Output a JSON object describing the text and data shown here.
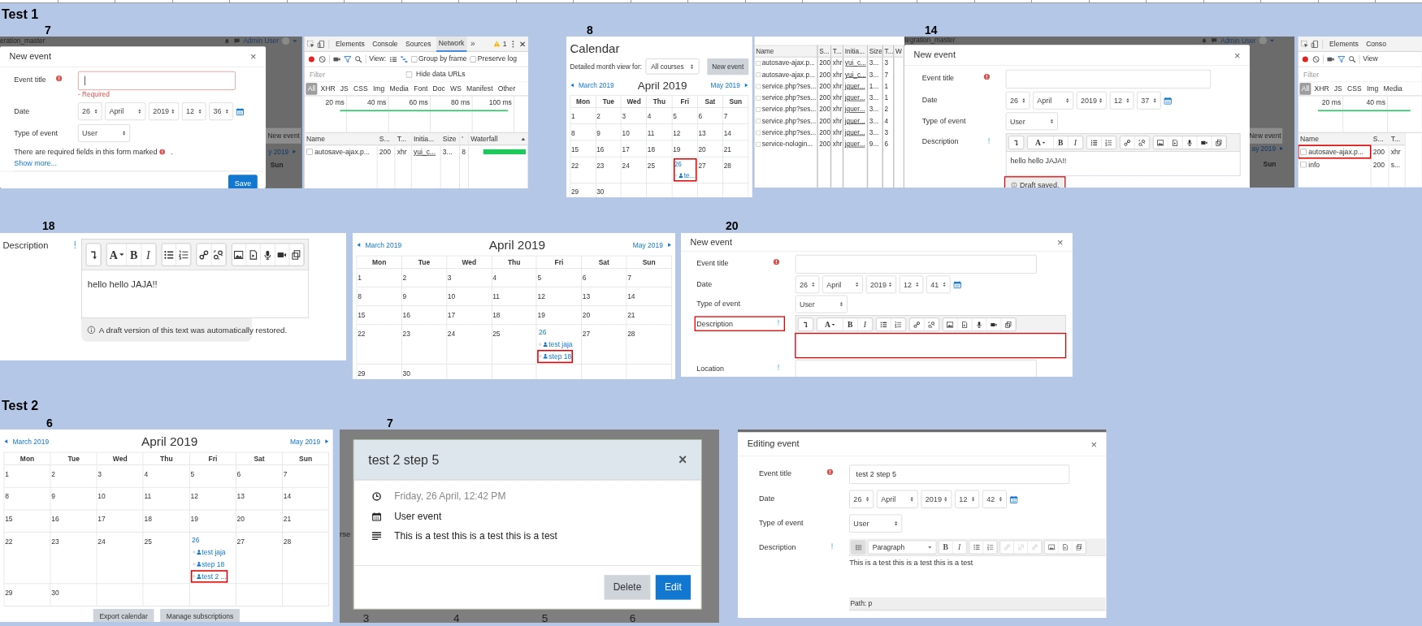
{
  "tests": [
    {
      "title": "Test 1",
      "steps": [
        {
          "label": "7",
          "panels": [
            {
              "kind": "event_form",
              "backdrop": {
                "site_name": "eration_master",
                "user_name": "Admin User",
                "button": "New event",
                "nav": "y 2019",
                "weekday": "Sun"
              },
              "title": "New event",
              "close": "×",
              "fields": [
                {
                  "kind": "text",
                  "label": "Event title",
                  "required": true,
                  "focused": true,
                  "error": "- Required"
                },
                {
                  "kind": "date",
                  "label": "Date",
                  "day": "26",
                  "month": "April",
                  "year": "2019",
                  "hour": "12",
                  "minute": "36"
                },
                {
                  "kind": "select",
                  "label": "Type of event",
                  "value": "User"
                }
              ],
              "required_note": {
                "text": "There are required fields in this form marked",
                "end": "."
              },
              "show_more": "Show more...",
              "save": "Save"
            },
            {
              "kind": "devtools",
              "tabs": [
                {
                  "label": "Elements",
                  "selected": false
                },
                {
                  "label": "Console",
                  "selected": false
                },
                {
                  "label": "Sources",
                  "selected": false
                },
                {
                  "label": "Network",
                  "selected": true
                }
              ],
              "more": "»",
              "warnings": "1",
              "view_label": "View:",
              "options": [
                {
                  "label": "Group by frame",
                  "checked": false
                },
                {
                  "label": "Preserve log",
                  "checked": false
                }
              ],
              "filter_placeholder": "Filter",
              "hide_option": {
                "label": "Hide data URLs",
                "checked": false
              },
              "types": [
                {
                  "label": "All",
                  "selected": true
                },
                {
                  "label": "XHR",
                  "selected": false
                },
                {
                  "label": "JS",
                  "selected": false
                },
                {
                  "label": "CSS",
                  "selected": false
                },
                {
                  "label": "Img",
                  "selected": false
                },
                {
                  "label": "Media",
                  "selected": false
                },
                {
                  "label": "Font",
                  "selected": false
                },
                {
                  "label": "Doc",
                  "selected": false
                },
                {
                  "label": "WS",
                  "selected": false
                },
                {
                  "label": "Manifest",
                  "selected": false
                },
                {
                  "label": "Other",
                  "selected": false
                }
              ],
              "ticks": [
                "20 ms",
                "40 ms",
                "60 ms",
                "80 ms",
                "100 ms"
              ],
              "columns": [
                "Name",
                "S...",
                "T...",
                "Initia...",
                "Size",
                "'",
                "Waterfall"
              ],
              "rows": [
                {
                  "cells": [
                    "autosave-ajax.p...",
                    "200",
                    "xhr",
                    "yui_c...",
                    "3...",
                    "8"
                  ],
                  "marked": false
                }
              ]
            }
          ]
        },
        {
          "label": "8",
          "panels": [
            {
              "kind": "calendar",
              "heading": "Calendar",
              "view_label": "Detailed month view for:",
              "course_filter": "All courses",
              "new_event": "New event",
              "prev": "March 2019",
              "next": "May 2019",
              "month": "April 2019",
              "weekdays": [
                "Mon",
                "Tue",
                "Wed",
                "Thu",
                "Fri",
                "Sat",
                "Sun"
              ],
              "weeks": [
                [
                  "1",
                  "2",
                  "3",
                  "4",
                  "5",
                  "6",
                  "7"
                ],
                [
                  "8",
                  "9",
                  "10",
                  "11",
                  "12",
                  "13",
                  "14"
                ],
                [
                  "15",
                  "16",
                  "17",
                  "18",
                  "19",
                  "20",
                  "21"
                ],
                [
                  "22",
                  "23",
                  "24",
                  "25",
                  {
                    "day": "26",
                    "marked": true,
                    "events": [
                      {
                        "title": "te...",
                        "marked": false
                      }
                    ]
                  },
                  "27",
                  "28"
                ],
                [
                  "29",
                  "30"
                ]
              ]
            },
            {
              "kind": "request_list",
              "columns": [
                "Name",
                "S...",
                "T...",
                "Initia...",
                "Size",
                "T...",
                "W"
              ],
              "rows": [
                {
                  "cells": [
                    "autosave-ajax.p...",
                    "200",
                    "xhr",
                    "yui_c...",
                    "3...",
                    "3"
                  ]
                },
                {
                  "cells": [
                    "autosave-ajax.p...",
                    "200",
                    "xhr",
                    "yui_c...",
                    "3...",
                    "7"
                  ]
                },
                {
                  "cells": [
                    "service.php?ses...",
                    "200",
                    "xhr",
                    "jquer...",
                    "1...",
                    "1"
                  ]
                },
                {
                  "cells": [
                    "service.php?ses...",
                    "200",
                    "xhr",
                    "jquer...",
                    "3...",
                    "1"
                  ]
                },
                {
                  "cells": [
                    "service.php?ses...",
                    "200",
                    "xhr",
                    "jquer...",
                    "3...",
                    "2"
                  ]
                },
                {
                  "cells": [
                    "service.php?ses...",
                    "200",
                    "xhr",
                    "jquer...",
                    "3...",
                    "4"
                  ]
                },
                {
                  "cells": [
                    "service.php?ses...",
                    "200",
                    "xhr",
                    "jquer...",
                    "3...",
                    "3"
                  ]
                },
                {
                  "cells": [
                    "service-nologin...",
                    "200",
                    "xhr",
                    "jquer...",
                    "9...",
                    "6"
                  ]
                }
              ]
            }
          ]
        },
        {
          "label": "14",
          "panels": [
            {
              "kind": "event_form",
              "backdrop": {
                "site_name": "tegration_master",
                "user_name": "Admin User",
                "button": "New event",
                "nav": "ay 2019",
                "weekday": "Sun"
              },
              "title": "New event",
              "close": "×",
              "fields": [
                {
                  "kind": "text",
                  "label": "Event title",
                  "required": true
                },
                {
                  "kind": "date",
                  "label": "Date",
                  "day": "26",
                  "month": "April",
                  "year": "2019",
                  "hour": "12",
                  "minute": "37"
                },
                {
                  "kind": "select",
                  "label": "Type of event",
                  "value": "User"
                },
                {
                  "kind": "editor",
                  "label": "Description",
                  "help": true,
                  "letters": [
                    "A",
                    "B",
                    "I"
                  ],
                  "text": "hello hello JAJA!!",
                  "status": "Draft saved.",
                  "status_marked": true
                }
              ]
            },
            {
              "kind": "devtools",
              "tabs": [
                {
                  "label": "Elements",
                  "selected": false
                },
                {
                  "label": "Conso",
                  "selected": false
                }
              ],
              "view_label": "View",
              "filter_placeholder": "Filter",
              "types": [
                {
                  "label": "All",
                  "selected": true
                },
                {
                  "label": "XHR",
                  "selected": false
                },
                {
                  "label": "JS",
                  "selected": false
                },
                {
                  "label": "CSS",
                  "selected": false
                },
                {
                  "label": "Img",
                  "selected": false
                },
                {
                  "label": "Media",
                  "selected": false
                }
              ],
              "ticks": [
                "20 ms",
                "40 ms"
              ],
              "columns": [
                "Name",
                "S...",
                "T..."
              ],
              "rows": [
                {
                  "cells": [
                    "autosave-ajax.p...",
                    "200",
                    "xhr"
                  ],
                  "marked": true
                },
                {
                  "cells": [
                    "info",
                    "200",
                    "s..."
                  ],
                  "marked": false
                }
              ]
            }
          ]
        },
        {
          "label": "18",
          "panels": [
            {
              "kind": "editor_crop",
              "label": "Description",
              "letters": [
                "A",
                "B",
                "I"
              ],
              "text": "hello hello JAJA!!",
              "restored_note": "A draft version of this text was automatically restored."
            },
            {
              "kind": "calendar",
              "prev": "March 2019",
              "next": "May 2019",
              "month": "April 2019",
              "weekdays": [
                "Mon",
                "Tue",
                "Wed",
                "Thu",
                "Fri",
                "Sat",
                "Sun"
              ],
              "weeks": [
                [
                  "1",
                  "2",
                  "3",
                  "4",
                  "5",
                  "6",
                  "7"
                ],
                [
                  "8",
                  "9",
                  "10",
                  "11",
                  "12",
                  "13",
                  "14"
                ],
                [
                  "15",
                  "16",
                  "17",
                  "18",
                  "19",
                  "20",
                  "21"
                ],
                [
                  "22",
                  "23",
                  "24",
                  "25",
                  {
                    "day": "26",
                    "marked": false,
                    "events": [
                      {
                        "title": "test jaja",
                        "marked": false
                      },
                      {
                        "title": "step 18",
                        "marked": true
                      }
                    ]
                  },
                  "27",
                  "28"
                ],
                [
                  "29",
                  "30"
                ]
              ]
            }
          ]
        },
        {
          "label": "20",
          "panels": [
            {
              "kind": "event_form",
              "title": "New event",
              "close": "×",
              "fields": [
                {
                  "kind": "text",
                  "label": "Event title",
                  "required": true
                },
                {
                  "kind": "date",
                  "label": "Date",
                  "day": "26",
                  "month": "April",
                  "year": "2019",
                  "hour": "12",
                  "minute": "41"
                },
                {
                  "kind": "select",
                  "label": "Type of event",
                  "value": "User"
                },
                {
                  "kind": "editor",
                  "label": "Description",
                  "label_marked": true,
                  "help": true,
                  "letters": [
                    "A",
                    "B",
                    "I"
                  ],
                  "area_marked": true
                },
                {
                  "kind": "text",
                  "label": "Location",
                  "help": true
                }
              ]
            }
          ]
        }
      ]
    },
    {
      "title": "Test 2",
      "steps": [
        {
          "label": "6",
          "panels": [
            {
              "kind": "calendar",
              "prev": "March 2019",
              "next": "May 2019",
              "month": "April 2019",
              "weekdays": [
                "Mon",
                "Tue",
                "Wed",
                "Thu",
                "Fri",
                "Sat",
                "Sun"
              ],
              "weeks": [
                [
                  "1",
                  "2",
                  "3",
                  "4",
                  "5",
                  "6",
                  "7"
                ],
                [
                  "8",
                  "9",
                  "10",
                  "11",
                  "12",
                  "13",
                  "14"
                ],
                [
                  "15",
                  "16",
                  "17",
                  "18",
                  "19",
                  "20",
                  "21"
                ],
                [
                  "22",
                  "23",
                  "24",
                  "25",
                  {
                    "day": "26",
                    "marked": false,
                    "events": [
                      {
                        "title": "test jaja",
                        "marked": false
                      },
                      {
                        "title": "step 18",
                        "marked": false
                      },
                      {
                        "title": "test 2 ...",
                        "marked": true
                      }
                    ]
                  },
                  "27",
                  "28"
                ],
                [
                  "29",
                  "30"
                ]
              ],
              "footer_buttons": [
                "Export calendar",
                "Manage subscriptions"
              ]
            }
          ]
        },
        {
          "label": "7",
          "panels": [
            {
              "kind": "event_dialog",
              "backdrop_texts": [
                "rse",
                "3",
                "4",
                "5",
                "6"
              ],
              "title": "test 2 step 5",
              "close": "×",
              "details": [
                {
                  "text": "Friday, 26 April, 12:42 PM",
                  "muted": true
                },
                {
                  "text": "User event",
                  "muted": false
                },
                {
                  "text": "This is a test this is a test this is a test",
                  "muted": false
                }
              ],
              "buttons": [
                {
                  "label": "Delete",
                  "primary": false
                },
                {
                  "label": "Edit",
                  "primary": true
                }
              ]
            },
            {
              "kind": "event_form",
              "title": "Editing event",
              "close": "×",
              "fields": [
                {
                  "kind": "text",
                  "label": "Event title",
                  "required": true,
                  "value": "test 2 step 5"
                },
                {
                  "kind": "date",
                  "label": "Date",
                  "day": "26",
                  "month": "April",
                  "year": "2019",
                  "hour": "12",
                  "minute": "42"
                },
                {
                  "kind": "select",
                  "label": "Type of event",
                  "value": "User"
                },
                {
                  "kind": "tinymce",
                  "label": "Description",
                  "help": true,
                  "format": "Paragraph",
                  "letters": [
                    "B",
                    "I"
                  ],
                  "text": "This is a test this is a test this is a test",
                  "path": "Path: p"
                }
              ]
            }
          ]
        }
      ]
    }
  ]
}
